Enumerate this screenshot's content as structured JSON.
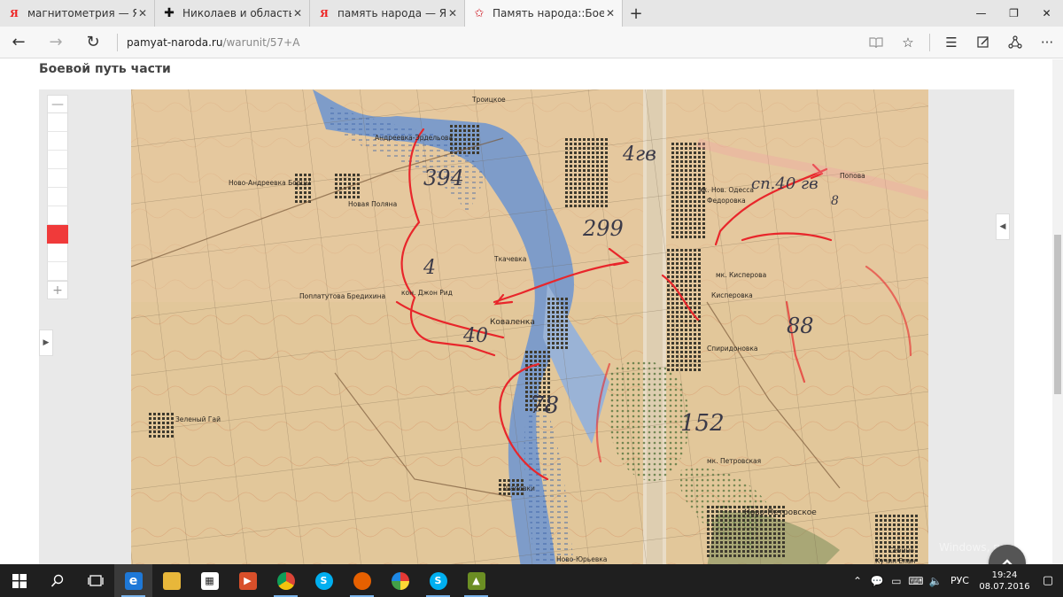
{
  "browser": {
    "tabs": [
      {
        "favicon": "yandex-icon",
        "title": "магнитометрия — Яндекс:",
        "active": false
      },
      {
        "favicon": "cross-icon",
        "title": "Николаев и область. | Стра",
        "active": false
      },
      {
        "favicon": "yandex-icon",
        "title": "память народа — Яндекс: н",
        "active": false
      },
      {
        "favicon": "star-icon",
        "title": "Память народа::Боевоі",
        "active": true
      }
    ],
    "new_tab_label": "+",
    "window_controls": [
      "—",
      "❐",
      "✕"
    ],
    "url_domain": "pamyat-naroda.ru",
    "url_path": "/warunit/57+A",
    "toolbar_icons": [
      "reading-view-icon",
      "favorite-star-icon",
      "hub-icon",
      "web-note-icon",
      "share-icon",
      "more-icon"
    ]
  },
  "page": {
    "title": "Боевой путь части",
    "zoom_levels": 9,
    "active_zoom_level": 7,
    "zoom_in_label": "+",
    "zoom_out_label": "—",
    "scroll_top_icon": "chevron-up-icon",
    "watermark": "Windows, перейдите в"
  },
  "map": {
    "place_labels": [
      "Троицкое",
      "Андреевка-Эрдельова",
      "Ново-Андреевка Борцы",
      "Новая Поляна",
      "мк. Нов. Одесса",
      "Федоровка",
      "Попова",
      "Ткачевка",
      "Кисперовка",
      "мк. Кисперова",
      "Поплатутова Бредихина",
      "Коваленка",
      "Спиридоновка",
      "Зеленый Гай",
      "Шаповки",
      "Ново-Петровское",
      "Ново-Юрьевка",
      "мк. Петровская",
      "Себино",
      "Кучин Елан",
      "кон. Джон Рид"
    ],
    "unit_numbers": [
      "394",
      "4",
      "40",
      "78",
      "152",
      "88",
      "299",
      "4гв",
      "сп.40 гв",
      "8"
    ],
    "colors": {
      "paper": "#e2c79a",
      "water": "#7e9cc9",
      "route": "#e8262b",
      "settlement": "#4f4a3a",
      "forest": "#7a8d5a"
    }
  },
  "taskbar": {
    "apps": [
      "start-icon",
      "search-icon",
      "task-view-icon",
      "edge-icon",
      "file-explorer-icon",
      "store-icon",
      "media-player-icon",
      "chrome-icon",
      "skype-icon",
      "firefox-icon",
      "picasa-icon",
      "skype-icon-2",
      "app-icon"
    ],
    "tray_icons": [
      "chevron-up-icon",
      "speech-icon",
      "network-icon",
      "keyboard-icon",
      "volume-icon"
    ],
    "language": "РУС",
    "time": "19:24",
    "date": "08.07.2016"
  }
}
